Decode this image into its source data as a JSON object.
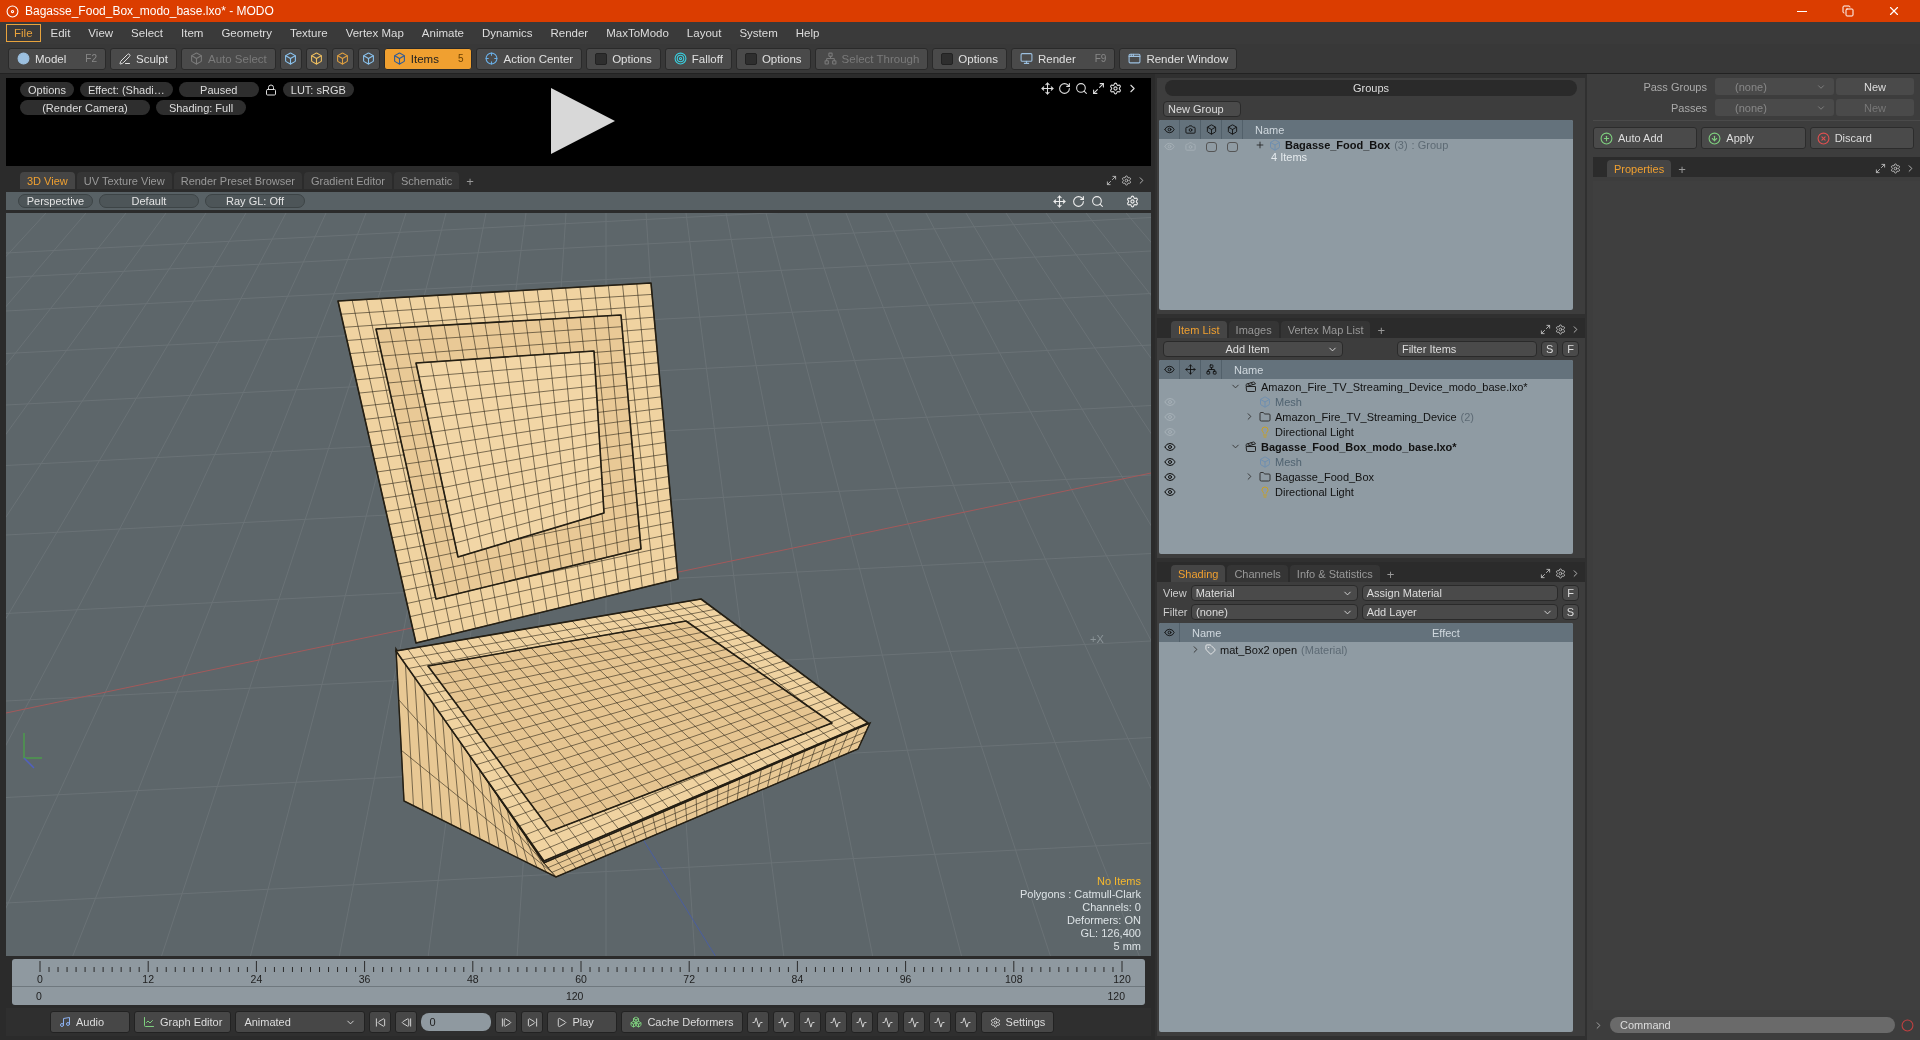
{
  "window": {
    "title": "Bagasse_Food_Box_modo_base.lxo* - MODO"
  },
  "menu": [
    {
      "label": "File",
      "selected": true
    },
    {
      "label": "Edit",
      "selected": false
    },
    {
      "label": "View",
      "selected": false
    },
    {
      "label": "Select",
      "selected": false
    },
    {
      "label": "Item",
      "selected": false
    },
    {
      "label": "Geometry",
      "selected": false
    },
    {
      "label": "Texture",
      "selected": false
    },
    {
      "label": "Vertex Map",
      "selected": false
    },
    {
      "label": "Animate",
      "selected": false
    },
    {
      "label": "Dynamics",
      "selected": false
    },
    {
      "label": "Render",
      "selected": false
    },
    {
      "label": "MaxToModo",
      "selected": false
    },
    {
      "label": "Layout",
      "selected": false
    },
    {
      "label": "System",
      "selected": false
    },
    {
      "label": "Help",
      "selected": false
    }
  ],
  "toolbar": [
    {
      "kind": "button",
      "label": "Model",
      "shortcut": "F2",
      "selected": false,
      "disabled": false
    },
    {
      "kind": "button",
      "label": "Sculpt",
      "selected": false,
      "disabled": false
    },
    {
      "kind": "button",
      "label": "Auto Select",
      "selected": false,
      "disabled": true
    },
    {
      "kind": "iconset"
    },
    {
      "kind": "button",
      "label": "Items",
      "shortcut": "5",
      "selected": true,
      "disabled": false
    },
    {
      "kind": "button",
      "label": "Action Center",
      "selected": false,
      "disabled": false
    },
    {
      "kind": "toggle",
      "label": "Options",
      "checked": false
    },
    {
      "kind": "button",
      "label": "Falloff",
      "selected": false,
      "disabled": false
    },
    {
      "kind": "toggle",
      "label": "Options",
      "checked": false
    },
    {
      "kind": "button",
      "label": "Select Through",
      "selected": false,
      "disabled": true
    },
    {
      "kind": "toggle",
      "label": "Options",
      "checked": false
    },
    {
      "kind": "button",
      "label": "Render",
      "shortcut": "F9",
      "selected": false,
      "disabled": false
    },
    {
      "kind": "button",
      "label": "Render Window",
      "selected": false,
      "disabled": false
    }
  ],
  "preview": {
    "row1": [
      "Options",
      "Effect: (Shadi…",
      "Paused",
      "LUT: sRGB"
    ],
    "row2": [
      "(Render Camera)",
      "Shading: Full"
    ]
  },
  "viewport": {
    "tabs": [
      {
        "label": "3D View",
        "selected": true
      },
      {
        "label": "UV Texture View",
        "selected": false
      },
      {
        "label": "Render Preset Browser",
        "selected": false
      },
      {
        "label": "Gradient Editor",
        "selected": false
      },
      {
        "label": "Schematic",
        "selected": false
      }
    ],
    "add_tab": "+",
    "controls": [
      "Perspective",
      "Default",
      "Ray GL: Off"
    ],
    "axis_label": "+X",
    "stats": [
      {
        "kind": "status",
        "text": "No Items"
      },
      {
        "kind": "info",
        "text": "Polygons : Catmull-Clark"
      },
      {
        "kind": "info",
        "text": "Channels: 0"
      },
      {
        "kind": "info",
        "text": "Deformers: ON"
      },
      {
        "kind": "info",
        "text": "GL: 126,400"
      },
      {
        "kind": "info",
        "text": "5 mm"
      }
    ]
  },
  "timeline": {
    "ticks": [
      "0",
      "12",
      "24",
      "36",
      "48",
      "60",
      "72",
      "84",
      "96",
      "108",
      "120"
    ],
    "range": [
      "0",
      "120",
      "120"
    ]
  },
  "bottom_bar": {
    "audio": "Audio",
    "graph_editor": "Graph Editor",
    "mode": "Animated",
    "frame": "0",
    "play": "Play",
    "cache": "Cache Deformers",
    "settings": "Settings"
  },
  "groups": {
    "title": "Groups",
    "new_group": "New Group",
    "column": "Name",
    "rows": [
      {
        "name": "Bagasse_Food_Box",
        "count": "(3)",
        "type": ": Group",
        "sub": "4 Items",
        "checks": [
          {
            "checked": false
          },
          {
            "checked": false
          }
        ]
      }
    ]
  },
  "item_list": {
    "tabs": [
      {
        "label": "Item List",
        "selected": true
      },
      {
        "label": "Images",
        "selected": false
      },
      {
        "label": "Vertex Map List",
        "selected": false
      }
    ],
    "add_tab": "+",
    "add_item": "Add Item",
    "filter_placeholder": "Filter Items",
    "s": "S",
    "f": "F",
    "column": "Name",
    "tree": [
      {
        "kind": "scene",
        "name": "Amazon_Fire_TV_Streaming_Device_modo_base.lxo*",
        "current": false,
        "expanded": true,
        "children": [
          {
            "kind": "mesh",
            "name": "Mesh",
            "current": false,
            "visible": false
          },
          {
            "kind": "group",
            "name": "Amazon_Fire_TV_Streaming_Device",
            "count": "(2)",
            "current": false,
            "visible": false,
            "expanded": false
          },
          {
            "kind": "light",
            "name": "Directional Light",
            "current": false,
            "visible": false
          }
        ]
      },
      {
        "kind": "scene",
        "name": "Bagasse_Food_Box_modo_base.lxo*",
        "current": true,
        "visible": true,
        "expanded": true,
        "children": [
          {
            "kind": "mesh",
            "name": "Mesh",
            "current": false,
            "visible": true
          },
          {
            "kind": "group",
            "name": "Bagasse_Food_Box",
            "current": false,
            "visible": true,
            "expanded": false
          },
          {
            "kind": "light",
            "name": "Directional Light",
            "current": false,
            "visible": true
          }
        ]
      }
    ]
  },
  "shading": {
    "tabs": [
      {
        "label": "Shading",
        "selected": true
      },
      {
        "label": "Channels",
        "selected": false
      },
      {
        "label": "Info & Statistics",
        "selected": false
      }
    ],
    "add_tab": "+",
    "view_label": "View",
    "view": "Material",
    "assign": "Assign Material",
    "f": "F",
    "filter_label": "Filter",
    "filter": "(none)",
    "add_layer": "Add Layer",
    "s": "S",
    "columns": [
      "Name",
      "Effect"
    ],
    "rows": [
      {
        "name": "mat_Box2 open",
        "type": "(Material)"
      }
    ]
  },
  "passes": {
    "pass_groups_label": "Pass Groups",
    "pass_groups": "(none)",
    "new": "New",
    "passes_label": "Passes",
    "passes_value": "(none)",
    "passes_new": "New",
    "auto_add": "Auto Add",
    "apply": "Apply",
    "discard": "Discard"
  },
  "properties": {
    "tabs": [
      {
        "label": "Properties",
        "selected": true
      }
    ],
    "add_tab": "+"
  },
  "command": {
    "placeholder": "Command"
  }
}
